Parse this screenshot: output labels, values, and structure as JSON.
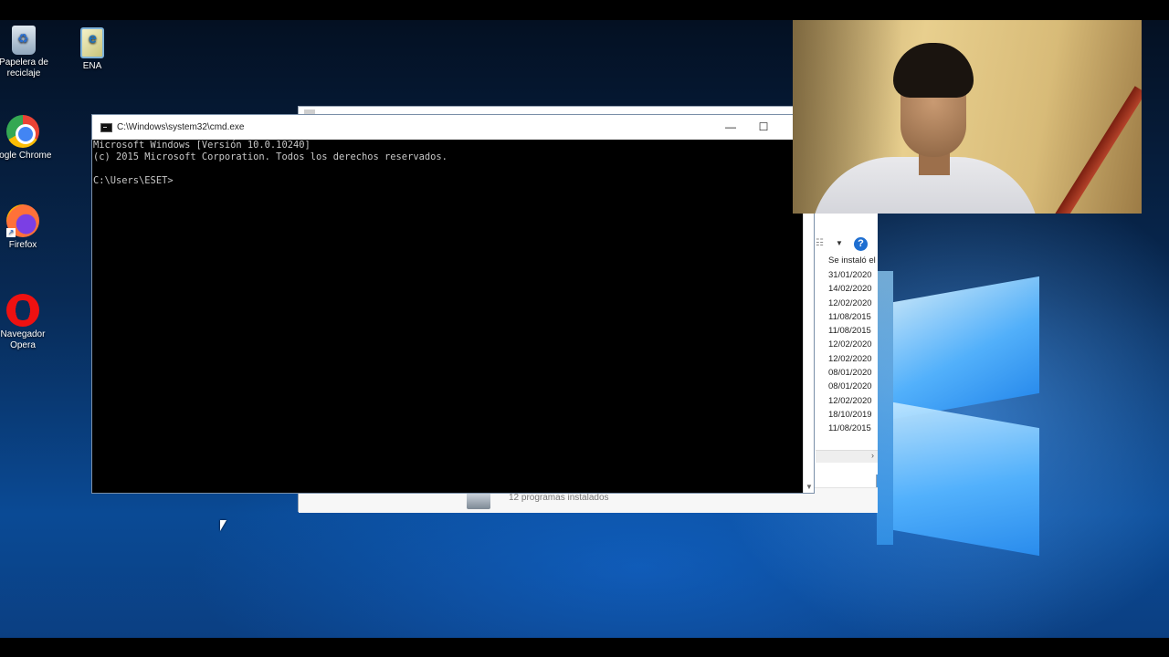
{
  "desktop": {
    "icons": [
      {
        "label": "Papelera de reciclaje",
        "icon": "recycle-bin-icon"
      },
      {
        "label": "ENA",
        "icon": "document-icon"
      },
      {
        "label": "oogle Chrome",
        "icon": "chrome-icon"
      },
      {
        "label": "Firefox",
        "icon": "firefox-icon"
      },
      {
        "label": "Navegador Opera",
        "icon": "opera-icon"
      }
    ]
  },
  "cmd": {
    "title": "C:\\Windows\\system32\\cmd.exe",
    "minimize": "—",
    "maximize": "☐",
    "output": "Microsoft Windows [Versión 10.0.10240]\n(c) 2015 Microsoft Corporation. Todos los derechos reservados.\n\nC:\\Users\\ESET>"
  },
  "explorer": {
    "column_header": "Se instaló el",
    "dates": [
      "31/01/2020",
      "14/02/2020",
      "12/02/2020",
      "11/08/2015",
      "11/08/2015",
      "12/02/2020",
      "12/02/2020",
      "08/01/2020",
      "08/01/2020",
      "12/02/2020",
      "18/10/2019",
      "11/08/2015"
    ],
    "status_text": "12 programas instalados",
    "help_label": "?"
  },
  "colors": {
    "accent": "#1f6fd1",
    "cmd_bg": "#000000",
    "cmd_text": "#c8c8c8"
  }
}
